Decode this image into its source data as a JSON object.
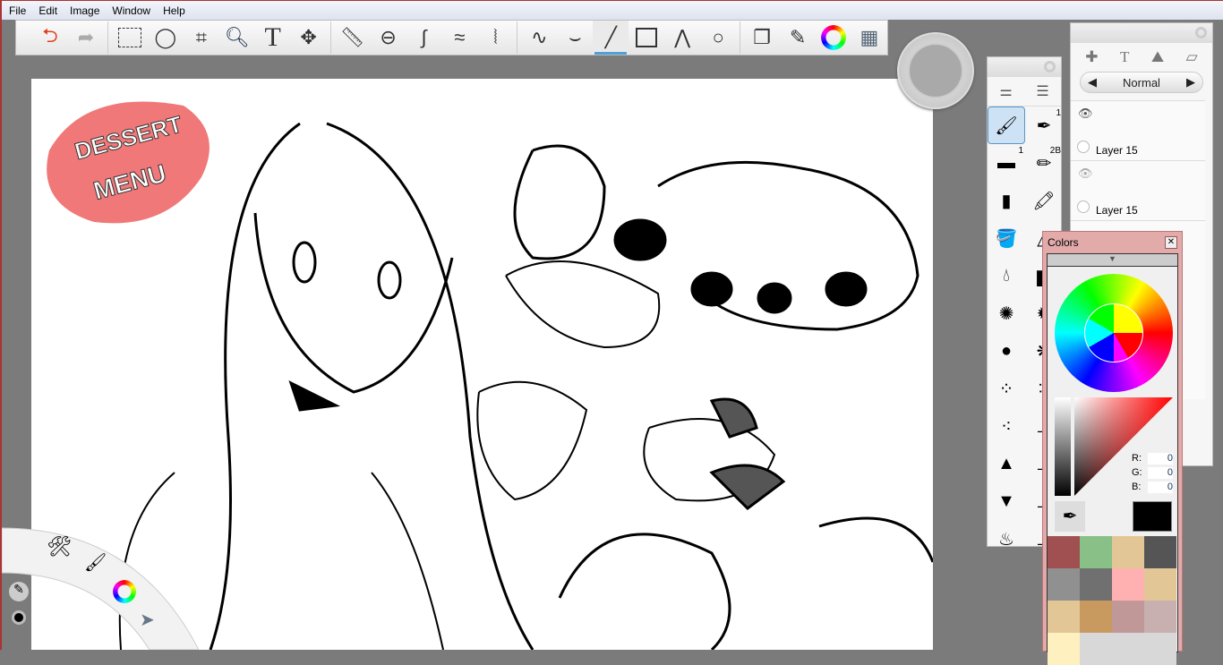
{
  "menu": [
    "File",
    "Edit",
    "Image",
    "Window",
    "Help"
  ],
  "toolbar": {
    "tools": [
      "undo",
      "redo",
      "rect-select",
      "lasso",
      "crop",
      "zoom",
      "text",
      "move",
      "ruler",
      "ellipse-guide",
      "french-curve",
      "symmetry-x",
      "symmetry-y",
      "pencil-line",
      "smooth-stroke",
      "line",
      "rectangle",
      "polyline",
      "ellipse",
      "layers",
      "brushes",
      "color-wheel",
      "copic-library"
    ],
    "selected": "line"
  },
  "layers": {
    "blend_mode": "Normal",
    "items": [
      {
        "name": "Layer 15",
        "visible": true
      },
      {
        "name": "Layer 15",
        "visible": true
      }
    ]
  },
  "brushes": {
    "items": [
      {
        "name": "airbrush",
        "selected": true
      },
      {
        "name": "ballpoint",
        "badge": "1"
      },
      {
        "name": "eraser",
        "badge": "1"
      },
      {
        "name": "pencil",
        "badge": "2B"
      },
      {
        "name": "smudge"
      },
      {
        "name": "marker"
      },
      {
        "name": "paint-bucket"
      },
      {
        "name": "chisel"
      },
      {
        "name": "water-drop"
      },
      {
        "name": "eraser-hard"
      },
      {
        "name": "splatter-1"
      },
      {
        "name": "splatter-2"
      },
      {
        "name": "splatter-3"
      },
      {
        "name": "splatter-4"
      },
      {
        "name": "splatter-5"
      },
      {
        "name": "splatter-6"
      },
      {
        "name": "dots"
      },
      {
        "name": "felt-pen"
      },
      {
        "name": "marker-blue"
      },
      {
        "name": "brush-2"
      },
      {
        "name": "paint-brush"
      },
      {
        "name": "brush-3"
      },
      {
        "name": "fan-brush"
      },
      {
        "name": "brush-4"
      }
    ]
  },
  "colors": {
    "title": "Colors",
    "r": "0",
    "g": "0",
    "b": "0",
    "r_label": "R:",
    "g_label": "G:",
    "b_label": "B:",
    "current": "#000000",
    "swatches": [
      "#a05050",
      "#88c088",
      "#e2c696",
      "#555555",
      "#909090",
      "#707070",
      "#ffb0b0",
      "#e2c696",
      "#e2c696",
      "#c89a60",
      "#c09898",
      "#c8b0b0",
      "#fff0c0",
      "#d8d8d8",
      "#d8d8d8",
      "#d8d8d8"
    ]
  },
  "canvas": {
    "watermark": "DESSERT MENU"
  }
}
